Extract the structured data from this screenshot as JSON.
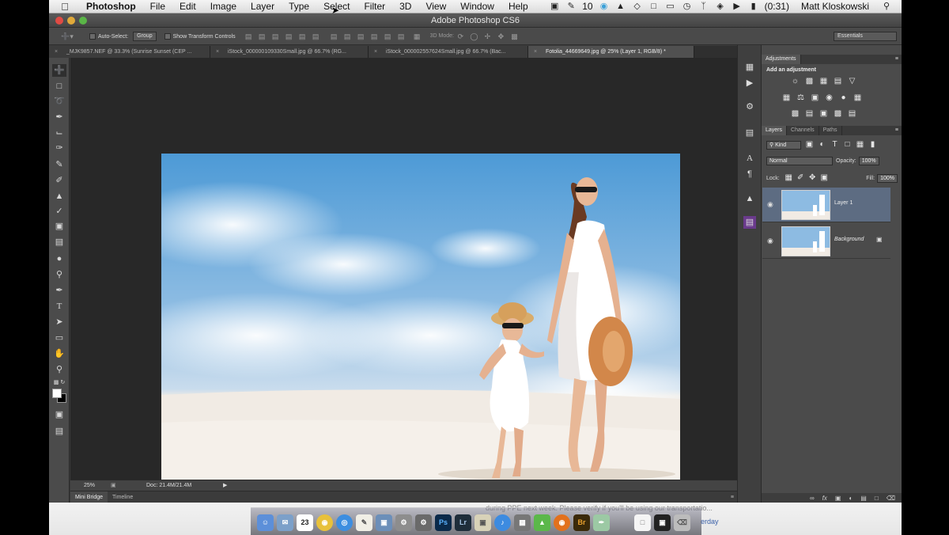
{
  "menubar": {
    "app_name": "Photoshop",
    "items": [
      "File",
      "Edit",
      "Image",
      "Layer",
      "Type",
      "Select",
      "Filter",
      "3D",
      "View",
      "Window",
      "Help"
    ],
    "status_badge": "10",
    "battery": "(0:31)",
    "user": "Matt Kloskowski"
  },
  "window": {
    "title": "Adobe Photoshop CS6"
  },
  "options": {
    "auto_select_label": "Auto-Select:",
    "auto_select_value": "Group",
    "transform_label": "Show Transform Controls",
    "mode_label": "3D Mode:",
    "workspace": "Essentials"
  },
  "tabs": [
    {
      "label": "_MJK9857.NEF @ 33.3% (Sunrise Sunset (CEP ...",
      "active": false
    },
    {
      "label": "iStock_000000109330Small.jpg @ 66.7% (RG...",
      "active": false
    },
    {
      "label": "iStock_000002557624Small.jpg @ 66.7% (Bac...",
      "active": false
    },
    {
      "label": "Fotolia_44669649.jpg @ 25% (Layer 1, RGB/8) *",
      "active": true
    }
  ],
  "status": {
    "zoom": "25%",
    "doc": "Doc: 21.4M/21.4M"
  },
  "bottom_tabs": [
    "Mini Bridge",
    "Timeline"
  ],
  "adjustments": {
    "title": "Adjustments",
    "subtitle": "Add an adjustment"
  },
  "layers_panel": {
    "tabs": [
      "Layers",
      "Channels",
      "Paths"
    ],
    "kind_label": "Kind",
    "blend_mode": "Normal",
    "opacity_label": "Opacity:",
    "opacity_value": "100%",
    "lock_label": "Lock:",
    "fill_label": "Fill:",
    "fill_value": "100%",
    "layers": [
      {
        "name": "Layer 1",
        "selected": true
      },
      {
        "name": "Background",
        "selected": false
      }
    ]
  },
  "dock": {
    "calendar_day": "23",
    "notification_text": "during PPE next week. Please verify if you'll be using our transportatio...",
    "notification_tail": "erday"
  },
  "colors": {
    "selected_layer": "#5d6c82",
    "canvas_bg": "#282828",
    "panel_bg": "#4b4b4b"
  }
}
